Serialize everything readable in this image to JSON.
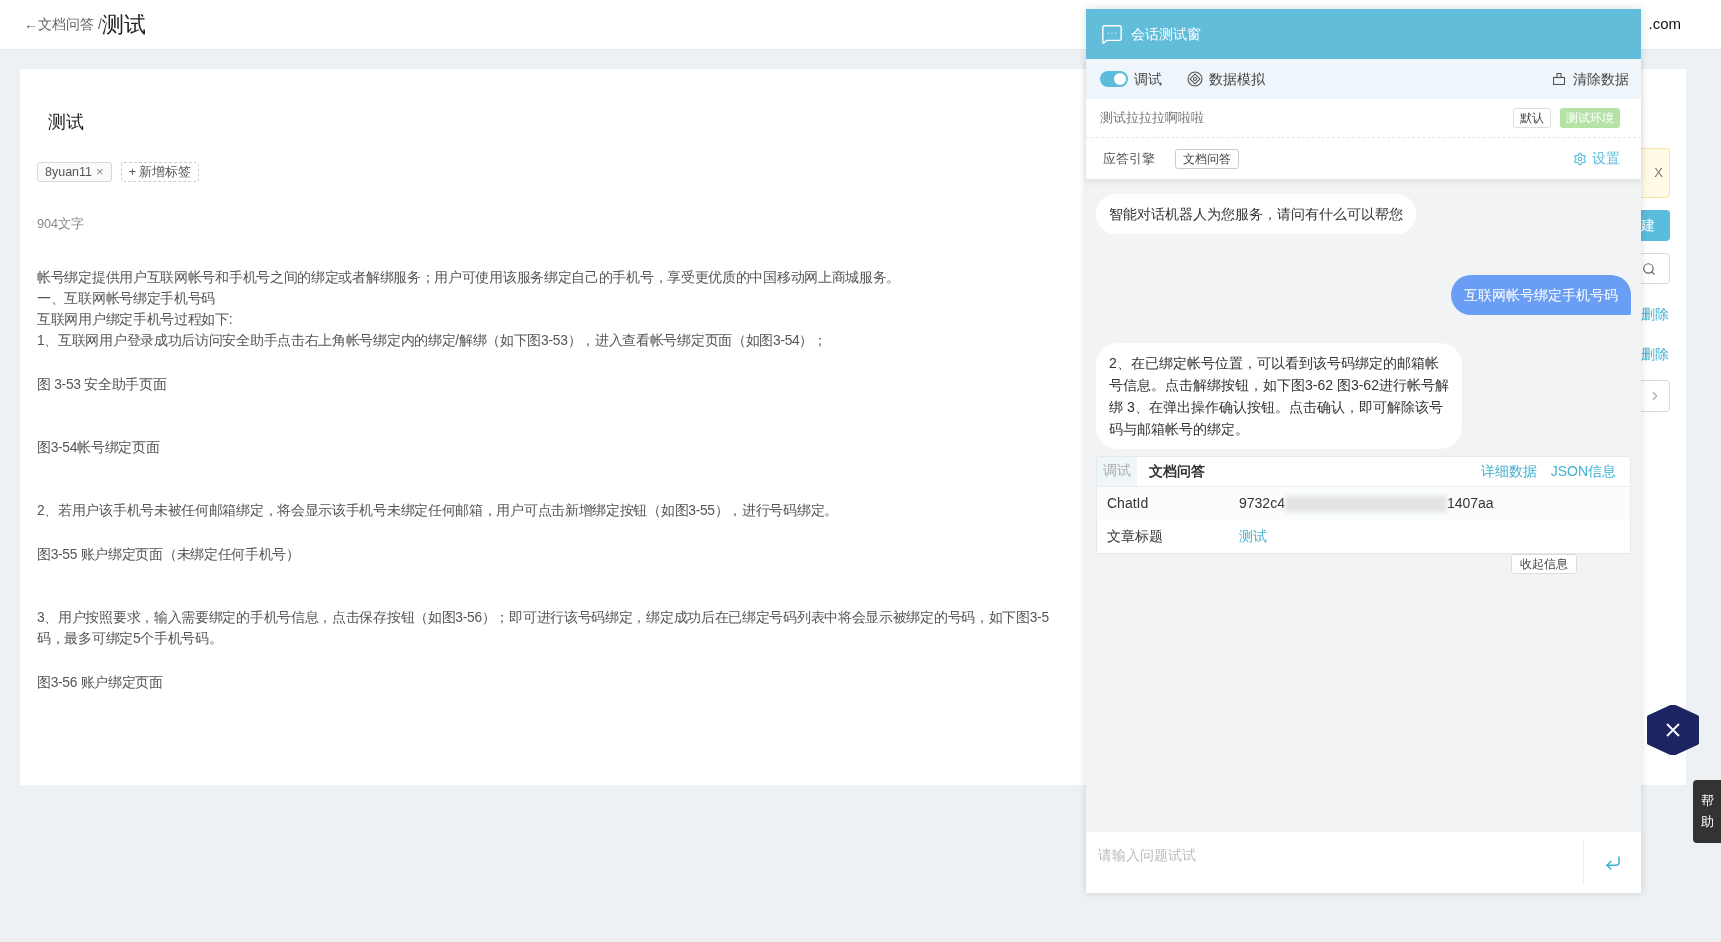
{
  "header": {
    "back_link": "←文档问答",
    "separator": "/",
    "title": "测试",
    "account": ".com"
  },
  "document": {
    "title": "测试",
    "tags": [
      {
        "label": "8yuan11",
        "close": "×"
      }
    ],
    "add_tag": "+ 新增标签",
    "word_count": "904文字",
    "blocks": [
      {
        "kind": "text",
        "lines": [
          "帐号绑定提供用户互联网帐号和手机号之间的绑定或者解绑服务；用户可使用该服务绑定自己的手机号，享受更优质的中国移动网上商城服务。",
          "一、互联网帐号绑定手机号码",
          "互联网用户绑定手机号过程如下:",
          "1、互联网用户登录成功后访问安全助手点击右上角帐号绑定内的绑定/解绑（如下图3-53），进入查看帐号绑定页面（如图3-54）；"
        ]
      },
      {
        "kind": "caption",
        "lines": [
          "图 3-53 安全助手页面"
        ]
      },
      {
        "kind": "caption",
        "lines": [
          "图3-54帐号绑定页面"
        ]
      },
      {
        "kind": "text",
        "lines": [
          "2、若用户该手机号未被任何邮箱绑定，将会显示该手机号未绑定任何邮箱，用户可点击新增绑定按钮（如图3-55），进行号码绑定。"
        ]
      },
      {
        "kind": "caption",
        "lines": [
          "图3-55 账户绑定页面（未绑定任何手机号）"
        ]
      },
      {
        "kind": "text",
        "lines": [
          "3、用户按照要求，输入需要绑定的手机号信息，点击保存按钮（如图3-56）；即可进行该号码绑定，绑定成功后在已绑定号码列表中将会显示被绑定的号码，如下图3-5",
          "码，最多可绑定5个手机号码。"
        ]
      },
      {
        "kind": "caption",
        "lines": [
          "图3-56 账户绑定页面"
        ]
      }
    ]
  },
  "side_fragments": {
    "alert_close": "X",
    "create_button": "建",
    "delete_links": [
      "删除",
      "删除"
    ]
  },
  "chat_panel": {
    "title": "会话测试窗",
    "debug_toggle": {
      "label": "调试",
      "on": true
    },
    "simulate": "数据模拟",
    "clear": "清除数据",
    "environment": {
      "name": "测试拉拉拉啊啦啦",
      "options": [
        {
          "label": "默认",
          "selected": false
        },
        {
          "label": "测试环境",
          "selected": true
        }
      ]
    },
    "engine": {
      "label": "应答引擎",
      "value": "文档问答",
      "settings": "设置"
    },
    "messages": [
      {
        "kind": "bot",
        "text": "智能对话机器人为您服务，请问有什么可以帮您"
      },
      {
        "kind": "user",
        "text": "互联网帐号绑定手机号码"
      },
      {
        "kind": "bot",
        "text": "2、在已绑定帐号位置，可以看到该号码绑定的邮箱帐号信息。点击解绑按钮，如下图3-62 图3-62进行帐号解绑 3、在弹出操作确认按钮。点击确认，即可解除该号码与邮箱帐号的绑定。"
      }
    ],
    "info_card": {
      "badge": "调试",
      "title": "文档问答",
      "links": [
        "详细数据",
        "JSON信息"
      ],
      "rows": [
        {
          "kind": "redacted",
          "label": "ChatId",
          "start": "9732c4",
          "end": "1407aa"
        },
        {
          "kind": "link",
          "label": "文章标题",
          "value": "测试"
        }
      ]
    },
    "collapse": "收起信息",
    "input": {
      "placeholder": "请输入问题试试"
    }
  },
  "help_tab": "帮助"
}
